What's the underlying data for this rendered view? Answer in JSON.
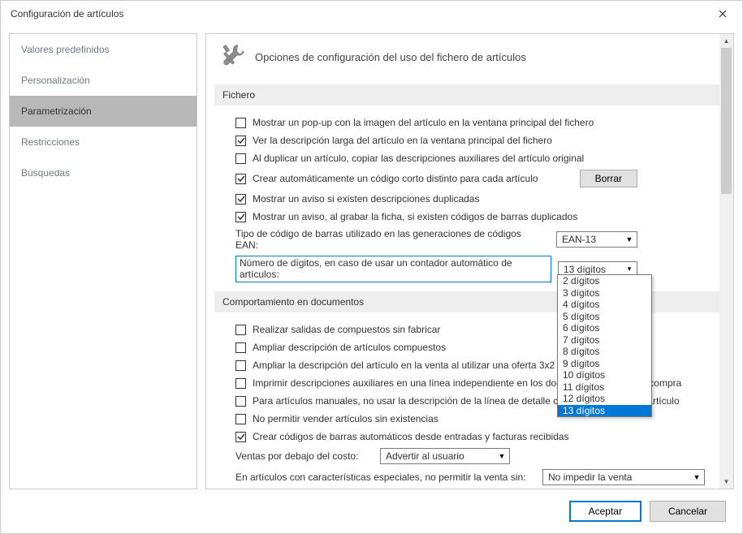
{
  "window": {
    "title": "Configuración de artículos"
  },
  "sidebar": {
    "items": [
      {
        "label": "Valores predefinidos"
      },
      {
        "label": "Personalización"
      },
      {
        "label": "Parametrización"
      },
      {
        "label": "Restricciones"
      },
      {
        "label": "Búsquedas"
      }
    ],
    "selected_index": 2
  },
  "main": {
    "heading": "Opciones de configuración del uso del fichero de artículos",
    "section_fichero": {
      "title": "Fichero",
      "chk_popup": {
        "label": "Mostrar un pop-up con la imagen del artículo en la ventana principal del fichero",
        "checked": false
      },
      "chk_desclarga": {
        "label": "Ver la descripción larga del artículo en la ventana principal del fichero",
        "checked": true
      },
      "chk_dupcopiar": {
        "label": "Al duplicar un artículo, copiar las descripciones auxiliares del artículo original",
        "checked": false
      },
      "chk_codcorto": {
        "label": "Crear automáticamente un código corto distinto para cada artículo",
        "checked": true
      },
      "btn_borrar": "Borrar",
      "chk_avisodup": {
        "label": "Mostrar un aviso si existen descripciones duplicadas",
        "checked": true
      },
      "chk_avisobarras": {
        "label": "Mostrar un aviso, al grabar la ficha, si existen códigos de barras duplicados",
        "checked": true
      },
      "row_tipocodigo": {
        "label": "Tipo de código de barras utilizado en las generaciones de códigos EAN:",
        "value": "EAN-13"
      },
      "row_digitos": {
        "label": "Número de dígitos, en caso de usar un contador automático de artículos:",
        "value": "13 dígitos"
      },
      "digitos_options": [
        "2 dígitos",
        "3 dígitos",
        "4 dígitos",
        "5 dígitos",
        "6 dígitos",
        "7 dígitos",
        "8 dígitos",
        "9 dígitos",
        "10 dígitos",
        "11 dígitos",
        "12 dígitos",
        "13 dígitos"
      ],
      "digitos_selected_index": 11
    },
    "section_comportamiento": {
      "title": "Comportamiento en documentos",
      "chk_salidas": {
        "label": "Realizar salidas de compuestos sin fabricar",
        "checked": false
      },
      "chk_ampliar": {
        "label": "Ampliar descripción de artículos compuestos",
        "checked": false
      },
      "chk_ampliarventa": {
        "label": "Ampliar la descripción del artículo en la venta al utilizar una oferta 3x2",
        "checked": false
      },
      "chk_imprimiraux": {
        "label": "Imprimir descripciones auxiliares en una línea independiente en los documentos de venta y compra",
        "checked": false
      },
      "chk_manual": {
        "label": "Para artículos manuales, no usar la descripción de la línea de detalle como descripción del artículo",
        "checked": false
      },
      "chk_nopermitir": {
        "label": "No permitir vender artículos sin existencias",
        "checked": false
      },
      "chk_crearcb": {
        "label": "Crear códigos de barras automáticos desde entradas y facturas recibidas",
        "checked": true
      },
      "row_costo": {
        "label": "Ventas por debajo del costo:",
        "value": "Advertir al usuario"
      },
      "row_especiales": {
        "label": "En artículos con características especiales, no permitir la venta sin:",
        "value": "No impedir la venta"
      }
    }
  },
  "footer": {
    "accept": "Aceptar",
    "cancel": "Cancelar"
  }
}
